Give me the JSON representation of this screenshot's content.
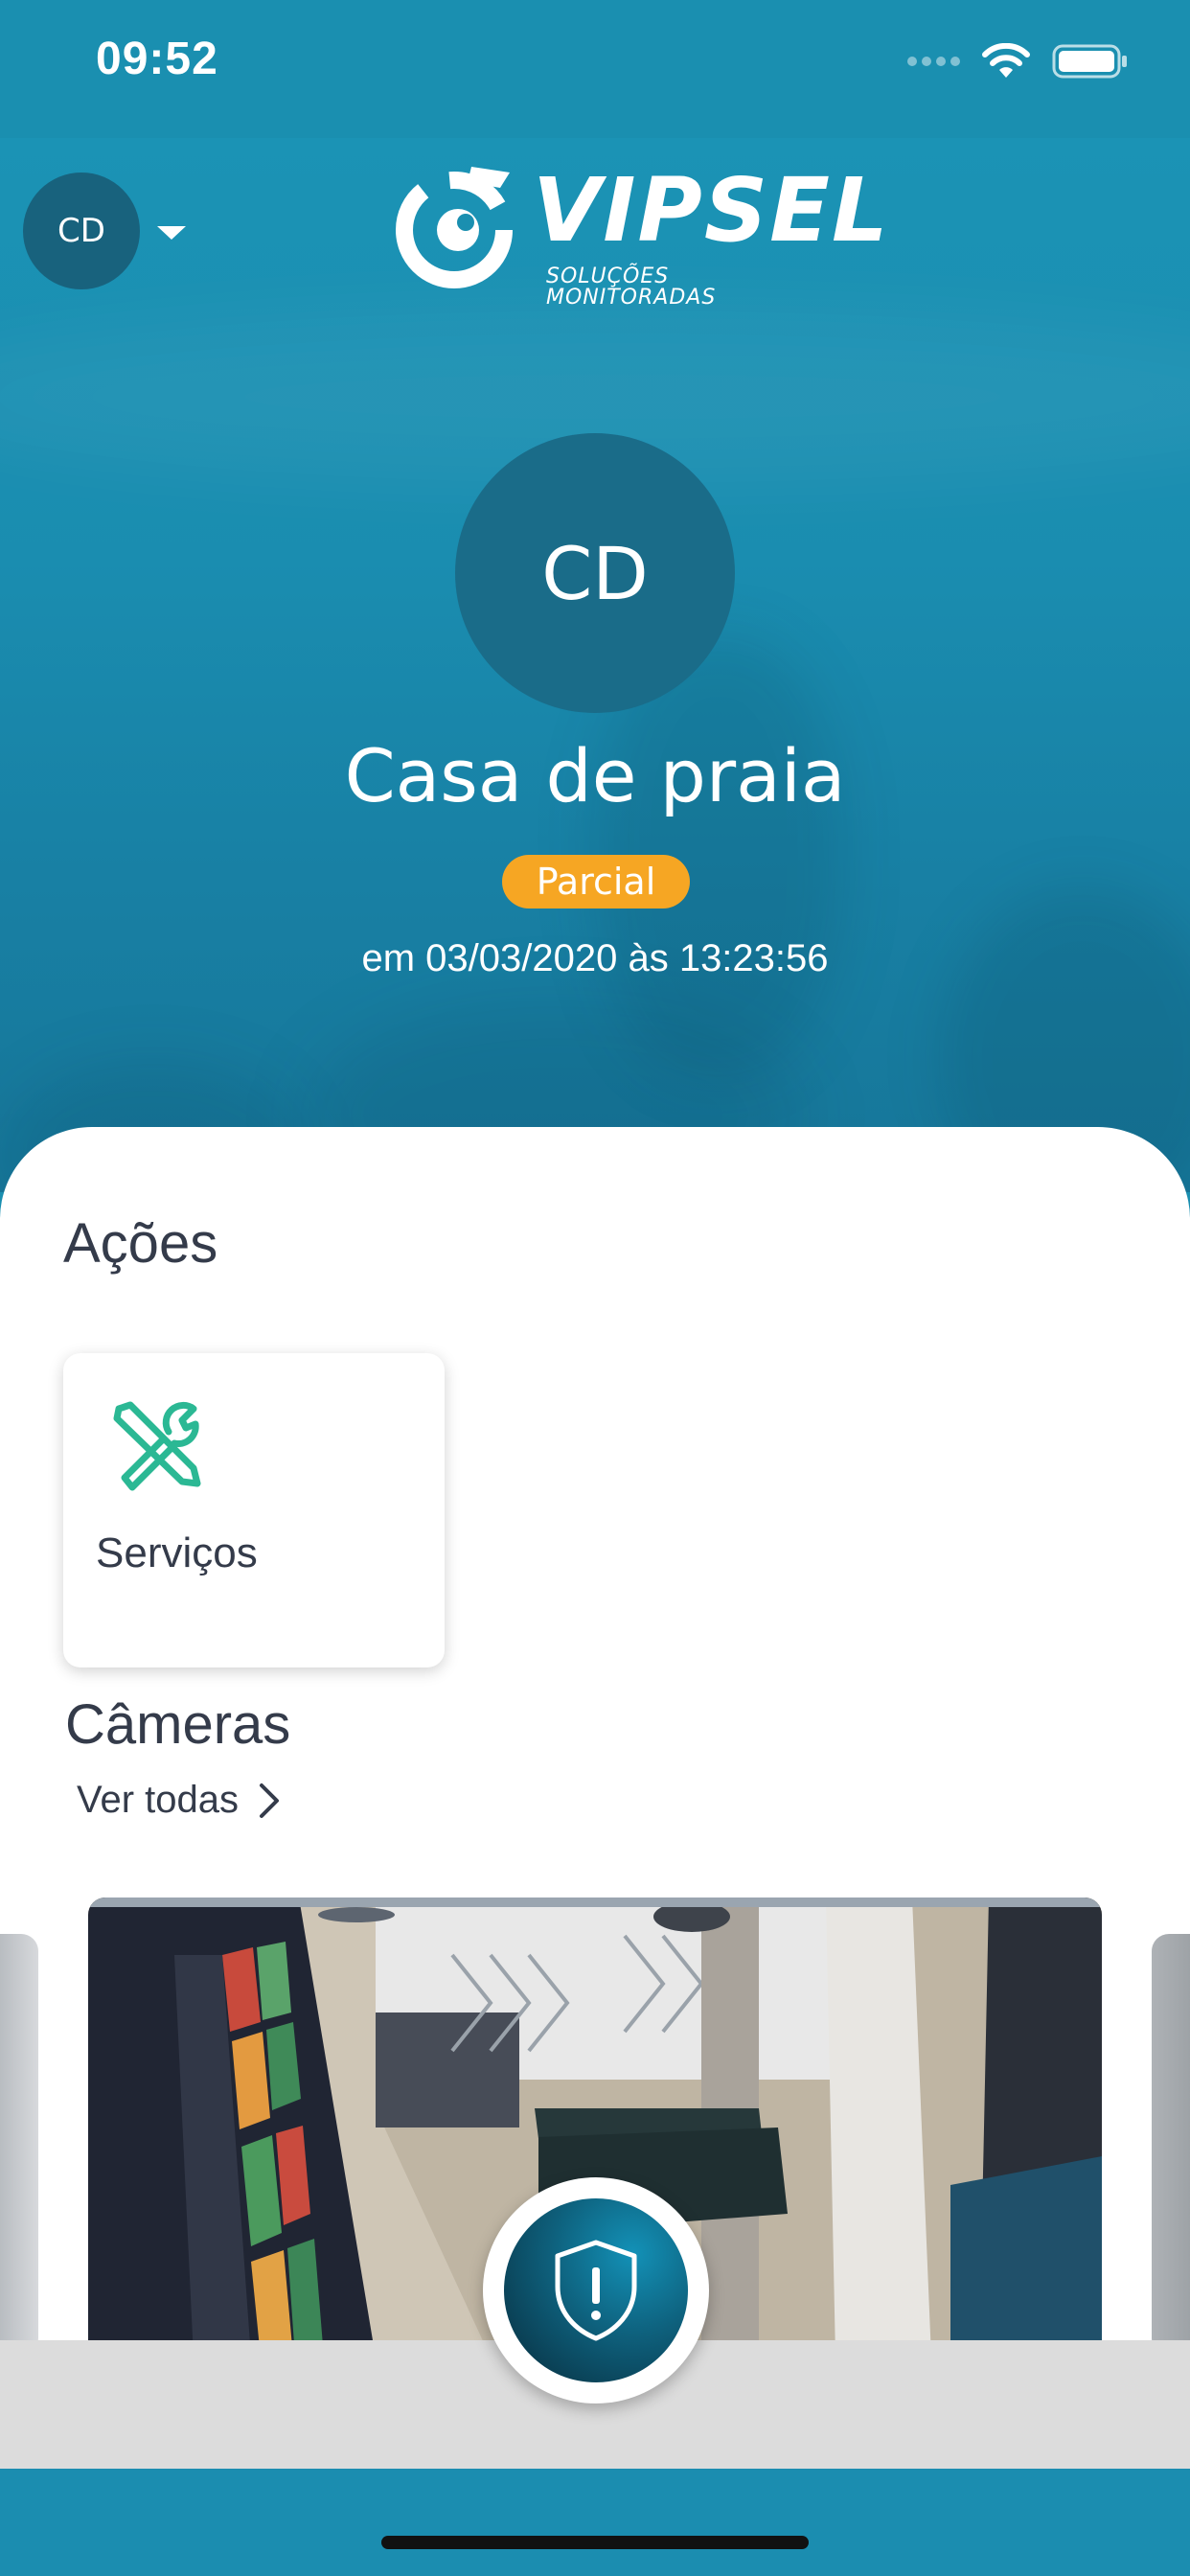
{
  "status_bar": {
    "time": "09:52"
  },
  "header": {
    "account_initials": "CD",
    "logo_brand": "VIPSEL",
    "logo_tagline": "SOLUÇÕES MONITORADAS"
  },
  "site": {
    "initials": "CD",
    "name": "Casa de praia",
    "status": "Parcial",
    "status_time": "em 03/03/2020 às 13:23:56"
  },
  "actions": {
    "title": "Ações",
    "items": [
      {
        "label": "Serviços",
        "icon": "tools-icon"
      }
    ]
  },
  "cameras": {
    "title": "Câmeras",
    "see_all": "Ver todas"
  },
  "colors": {
    "primary": "#1a8fb0",
    "status_partial": "#f6a623",
    "service_icon": "#2bb894",
    "text_dark": "#343b4a"
  }
}
